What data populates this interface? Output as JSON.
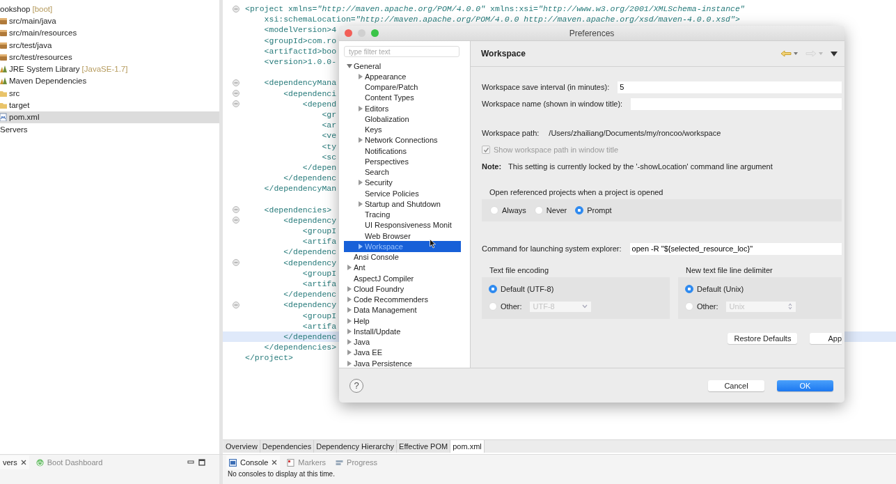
{
  "project_explorer": {
    "items": [
      {
        "label": "ookshop",
        "decoration": "[boot]",
        "kind": "project",
        "selected": false
      },
      {
        "label": "src/main/java",
        "kind": "package",
        "selected": false
      },
      {
        "label": "src/main/resources",
        "kind": "package",
        "selected": false
      },
      {
        "label": "src/test/java",
        "kind": "package",
        "selected": false
      },
      {
        "label": "src/test/resources",
        "kind": "package",
        "selected": false
      },
      {
        "label": "JRE System Library",
        "decoration": "[JavaSE-1.7]",
        "kind": "library",
        "selected": false
      },
      {
        "label": "Maven Dependencies",
        "kind": "library",
        "selected": false
      },
      {
        "label": "src",
        "kind": "folder",
        "selected": false
      },
      {
        "label": "target",
        "kind": "folder",
        "selected": false
      },
      {
        "label": "pom.xml",
        "kind": "xml",
        "selected": true
      },
      {
        "label": "Servers",
        "kind": "project",
        "selected": false
      }
    ]
  },
  "editor": {
    "lines": [
      {
        "text": "<project xmlns=*\"http://maven.apache.org/POM/4.0.0\"* xmlns:xsi=*\"http://www.w3.org/2001/XMLSchema-instance\"*",
        "fold": true,
        "current": false
      },
      {
        "text": "    xsi:schemaLocation=*\"http://maven.apache.org/POM/4.0.0 http://maven.apache.org/xsd/maven-4.0.0.xsd\"*>",
        "fold": false,
        "current": false
      },
      {
        "text": "    <modelVersion>4",
        "fold": false,
        "current": false
      },
      {
        "text": "    <groupId>com.ro",
        "fold": false,
        "current": false
      },
      {
        "text": "    <artifactId>boo",
        "fold": false,
        "current": false
      },
      {
        "text": "    <version>1.0.0-",
        "fold": false,
        "current": false
      },
      {
        "fold": false,
        "current": false
      },
      {
        "text": "    <dependencyMana",
        "fold": true,
        "current": false
      },
      {
        "text": "        <dependenci",
        "fold": true,
        "current": false
      },
      {
        "text": "            <depend",
        "fold": true,
        "current": false
      },
      {
        "text": "                <gr",
        "fold": false,
        "current": false
      },
      {
        "text": "                <ar",
        "fold": false,
        "current": false
      },
      {
        "text": "                <ve",
        "fold": false,
        "current": false
      },
      {
        "text": "                <ty",
        "fold": false,
        "current": false
      },
      {
        "text": "                <sc",
        "fold": false,
        "current": false
      },
      {
        "text": "            </depen",
        "fold": false,
        "current": false
      },
      {
        "text": "        </dependenc",
        "fold": false,
        "current": false
      },
      {
        "text": "    </dependencyMan",
        "fold": false,
        "current": false
      },
      {
        "fold": false,
        "current": false
      },
      {
        "text": "    <dependencies>",
        "fold": true,
        "current": false
      },
      {
        "text": "        <dependency",
        "fold": true,
        "current": false
      },
      {
        "text": "            <groupI",
        "fold": false,
        "current": false
      },
      {
        "text": "            <artifa",
        "fold": false,
        "current": false
      },
      {
        "text": "        </dependenc",
        "fold": false,
        "current": false
      },
      {
        "text": "        <dependency",
        "fold": true,
        "current": false
      },
      {
        "text": "            <groupI",
        "fold": false,
        "current": false
      },
      {
        "text": "            <artifa",
        "fold": false,
        "current": false
      },
      {
        "text": "        </dependenc",
        "fold": false,
        "current": false
      },
      {
        "text": "        <dependency",
        "fold": true,
        "current": false
      },
      {
        "text": "            <groupI",
        "fold": false,
        "current": false
      },
      {
        "text": "            <artifa",
        "fold": false,
        "current": false
      },
      {
        "text": "        </dependenc",
        "fold": false,
        "current": true
      },
      {
        "text": "    </dependencies>",
        "fold": false,
        "current": false
      },
      {
        "text": "</project>",
        "fold": false,
        "current": false
      }
    ],
    "tabs": [
      {
        "label": "Overview",
        "selected": false
      },
      {
        "label": "Dependencies",
        "selected": false
      },
      {
        "label": "Dependency Hierarchy",
        "selected": false
      },
      {
        "label": "Effective POM",
        "selected": false
      },
      {
        "label": "pom.xml",
        "selected": true
      }
    ]
  },
  "servers_panel": {
    "tabs": [
      {
        "label": "vers",
        "kind": "servers",
        "selected": true
      },
      {
        "label": "Boot Dashboard",
        "kind": "boot",
        "selected": false
      }
    ]
  },
  "console_panel": {
    "tabs": [
      {
        "label": "Console",
        "kind": "console",
        "selected": true
      },
      {
        "label": "Markers",
        "kind": "markers",
        "selected": false
      },
      {
        "label": "Progress",
        "kind": "progress",
        "selected": false
      }
    ],
    "message": "No consoles to display at this time."
  },
  "dialog": {
    "title": "Preferences",
    "filter": {
      "placeholder": "type filter text"
    },
    "tree": [
      {
        "label": "General",
        "expandable": true,
        "expanded": true,
        "selected": false,
        "children": [
          {
            "label": "Appearance",
            "expandable": true,
            "selected": false
          },
          {
            "label": "Compare/Patch",
            "expandable": false,
            "selected": false
          },
          {
            "label": "Content Types",
            "expandable": false,
            "selected": false
          },
          {
            "label": "Editors",
            "expandable": true,
            "selected": false
          },
          {
            "label": "Globalization",
            "expandable": false,
            "selected": false
          },
          {
            "label": "Keys",
            "expandable": false,
            "selected": false
          },
          {
            "label": "Network Connections",
            "expandable": true,
            "selected": false
          },
          {
            "label": "Notifications",
            "expandable": false,
            "selected": false
          },
          {
            "label": "Perspectives",
            "expandable": false,
            "selected": false
          },
          {
            "label": "Search",
            "expandable": false,
            "selected": false
          },
          {
            "label": "Security",
            "expandable": true,
            "selected": false
          },
          {
            "label": "Service Policies",
            "expandable": false,
            "selected": false
          },
          {
            "label": "Startup and Shutdown",
            "expandable": true,
            "selected": false
          },
          {
            "label": "Tracing",
            "expandable": false,
            "selected": false
          },
          {
            "label": "UI Responsiveness Monit",
            "expandable": false,
            "selected": false
          },
          {
            "label": "Web Browser",
            "expandable": false,
            "selected": false
          },
          {
            "label": "Workspace",
            "expandable": true,
            "selected": true
          }
        ]
      },
      {
        "label": "Ansi Console",
        "expandable": false,
        "selected": false
      },
      {
        "label": "Ant",
        "expandable": true,
        "selected": false
      },
      {
        "label": "AspectJ Compiler",
        "expandable": false,
        "selected": false
      },
      {
        "label": "Cloud Foundry",
        "expandable": true,
        "selected": false
      },
      {
        "label": "Code Recommenders",
        "expandable": true,
        "selected": false
      },
      {
        "label": "Data Management",
        "expandable": true,
        "selected": false
      },
      {
        "label": "Help",
        "expandable": true,
        "selected": false
      },
      {
        "label": "Install/Update",
        "expandable": true,
        "selected": false
      },
      {
        "label": "Java",
        "expandable": true,
        "selected": false
      },
      {
        "label": "Java EE",
        "expandable": true,
        "selected": false
      },
      {
        "label": "Java Persistence",
        "expandable": true,
        "selected": false
      }
    ],
    "page": {
      "title": "Workspace",
      "save_interval": {
        "label": "Workspace save interval (in minutes):",
        "value": "5"
      },
      "workspace_name": {
        "label": "Workspace name (shown in window title):"
      },
      "path": {
        "label": "Workspace path:",
        "value": "/Users/zhailiang/Documents/my/roncoo/workspace"
      },
      "show_path": {
        "label": "Show workspace path in window title",
        "checked": true,
        "disabled": true
      },
      "note": {
        "label": "Note:",
        "text": "This setting is currently locked by the '-showLocation' command line argument"
      },
      "open_referenced": {
        "label": "Open referenced projects when a project is opened",
        "options": [
          {
            "label": "Always",
            "selected": false
          },
          {
            "label": "Never",
            "selected": false
          },
          {
            "label": "Prompt",
            "selected": true
          }
        ]
      },
      "explorer_command": {
        "label": "Command for launching system explorer:",
        "value": "open -R \"${selected_resource_loc}\""
      },
      "encoding": {
        "label": "Text file encoding",
        "options": [
          {
            "label": "Default (UTF-8)",
            "selected": true
          },
          {
            "label": "Other:",
            "selected": false,
            "combo": "UTF-8"
          }
        ]
      },
      "delimiter": {
        "label": "New text file line delimiter",
        "options": [
          {
            "label": "Default (Unix)",
            "selected": true
          },
          {
            "label": "Other:",
            "selected": false,
            "combo": "Unix"
          }
        ]
      },
      "buttons": [
        "Restore Defaults",
        "App"
      ]
    },
    "help": "?",
    "buttons": [
      {
        "label": "Cancel",
        "default": false
      },
      {
        "label": "OK",
        "default": true
      }
    ]
  }
}
